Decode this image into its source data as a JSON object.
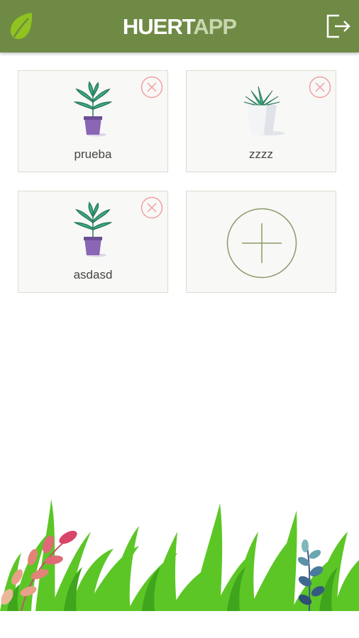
{
  "app": {
    "title_part1": "HUERT",
    "title_part2": "APP"
  },
  "colors": {
    "header": "#6f8a45",
    "accent": "#8a9a6a",
    "delete": "#f0a0a0"
  },
  "icons": {
    "logo": "leaf-icon",
    "logout": "logout-icon",
    "delete": "close-circle-icon",
    "add": "plus-circle-icon"
  },
  "plants": [
    {
      "name": "prueba",
      "image": "potted-palm-purple"
    },
    {
      "name": "zzzz",
      "image": "succulent-white-pot"
    },
    {
      "name": "asdasd",
      "image": "potted-palm-purple"
    }
  ]
}
